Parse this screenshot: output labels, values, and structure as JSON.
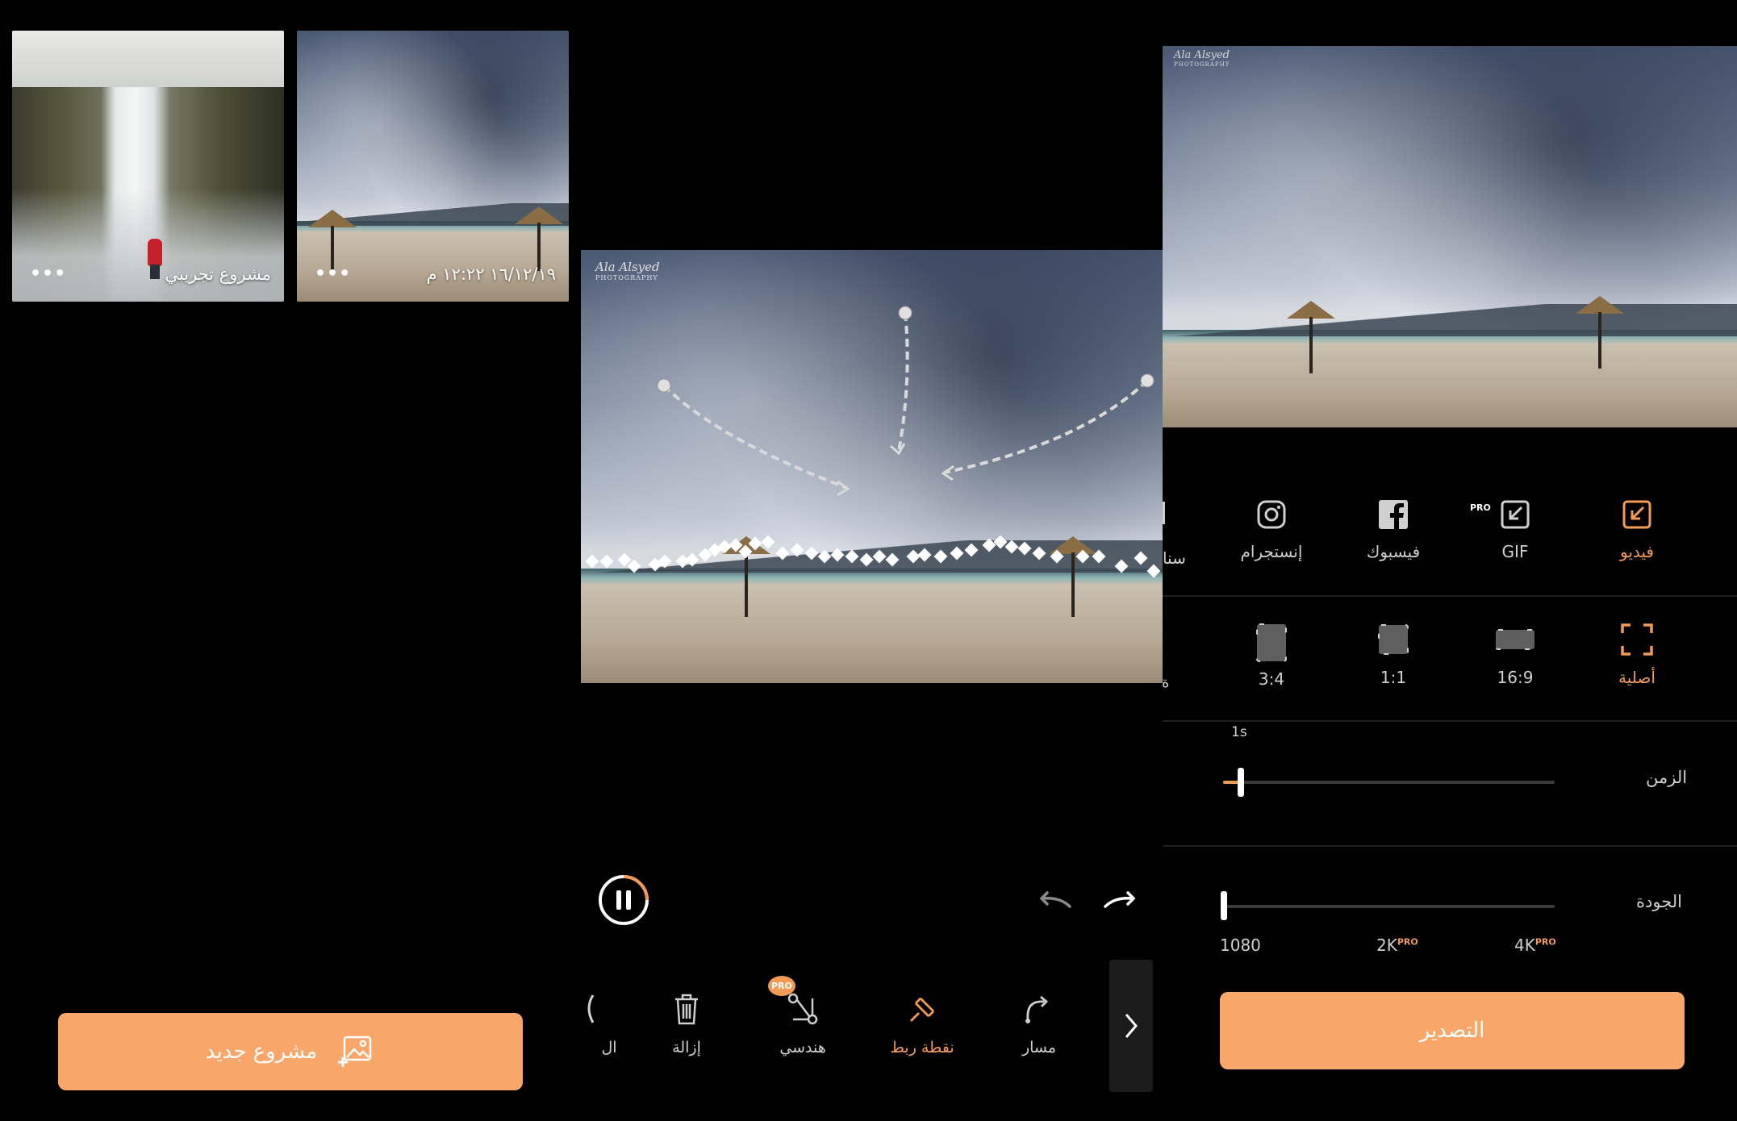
{
  "projects": [
    {
      "title": "مشروع تجريبي",
      "menu_label": "•••"
    },
    {
      "title": "١٦/١٢/١٩ ١٢:٢٢ م",
      "menu_label": "•••"
    }
  ],
  "new_project_label": "مشروع جديد",
  "watermark": {
    "line1": "Ala Alsyed",
    "line2": "PHOTOGRAPHY"
  },
  "share_options": [
    {
      "label": "فيديو",
      "icon": "export-video-icon",
      "active": true
    },
    {
      "label": "GIF",
      "icon": "export-gif-icon",
      "badge": "PRO"
    },
    {
      "label": "فيسبوك",
      "icon": "facebook-icon"
    },
    {
      "label": "إنستجرام",
      "icon": "instagram-icon"
    },
    {
      "label": "سنا",
      "icon": "snapchat-icon"
    }
  ],
  "aspect_ratios": [
    {
      "label": "أصلية",
      "active": true
    },
    {
      "label": "16:9"
    },
    {
      "label": "1:1"
    },
    {
      "label": "3:4"
    }
  ],
  "ratio_partial_label": "ة",
  "time": {
    "label": "الزمن",
    "value_label": "1s",
    "level": 0.02
  },
  "quality": {
    "label": "الجودة",
    "options": [
      {
        "label": "1080"
      },
      {
        "label": "2K",
        "badge": "PRO"
      },
      {
        "label": "4K",
        "badge": "PRO"
      }
    ],
    "level": 0
  },
  "export_label": "التصدير",
  "tools": [
    {
      "label": "مسار",
      "icon": "path-icon"
    },
    {
      "label": "نقطة ربط",
      "icon": "anchor-pin-icon",
      "active": true
    },
    {
      "label": "هندسي",
      "icon": "geometric-icon",
      "badge": "PRO"
    },
    {
      "label": "إزالة",
      "icon": "trash-icon"
    },
    {
      "label": "ال",
      "icon": "partial-tool-icon"
    }
  ],
  "colors": {
    "accent": "#f9a66a",
    "accent_text": "#f39a55",
    "background": "#000000"
  }
}
